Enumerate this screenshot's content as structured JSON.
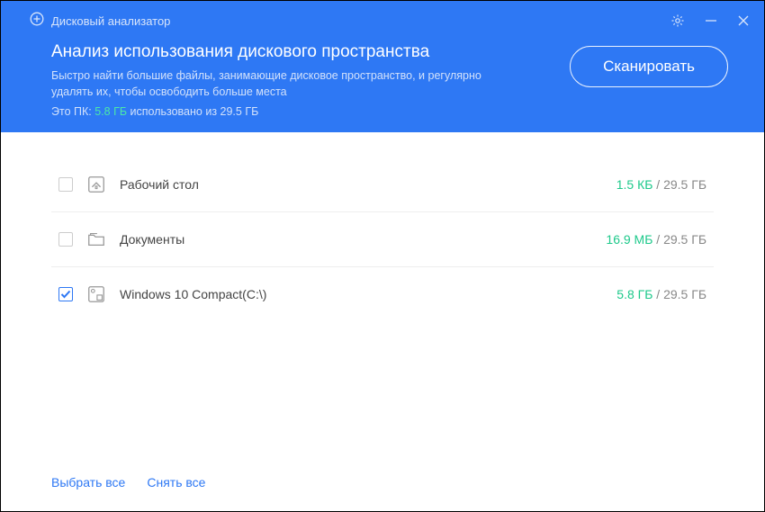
{
  "titlebar": {
    "app_title": "Дисковый анализатор"
  },
  "header": {
    "title": "Анализ использования дискового пространства",
    "description": "Быстро найти большие файлы, занимающие дисковое пространство, и регулярно удалять их, чтобы освободить больше места",
    "info_prefix": "Это ПК:",
    "info_used": "5.8 ГБ",
    "info_suffix": "использовано из 29.5 ГБ",
    "scan_button": "Сканировать"
  },
  "rows": [
    {
      "icon": "home",
      "name": "Рабочий стол",
      "used": "1.5 КБ",
      "total": "29.5 ГБ",
      "checked": false
    },
    {
      "icon": "folder",
      "name": "Документы",
      "used": "16.9 МБ",
      "total": "29.5 ГБ",
      "checked": false
    },
    {
      "icon": "disk",
      "name": "Windows 10 Compact(C:\\)",
      "used": "5.8 ГБ",
      "total": "29.5 ГБ",
      "checked": true
    }
  ],
  "footer": {
    "select_all": "Выбрать все",
    "deselect_all": "Снять все"
  }
}
